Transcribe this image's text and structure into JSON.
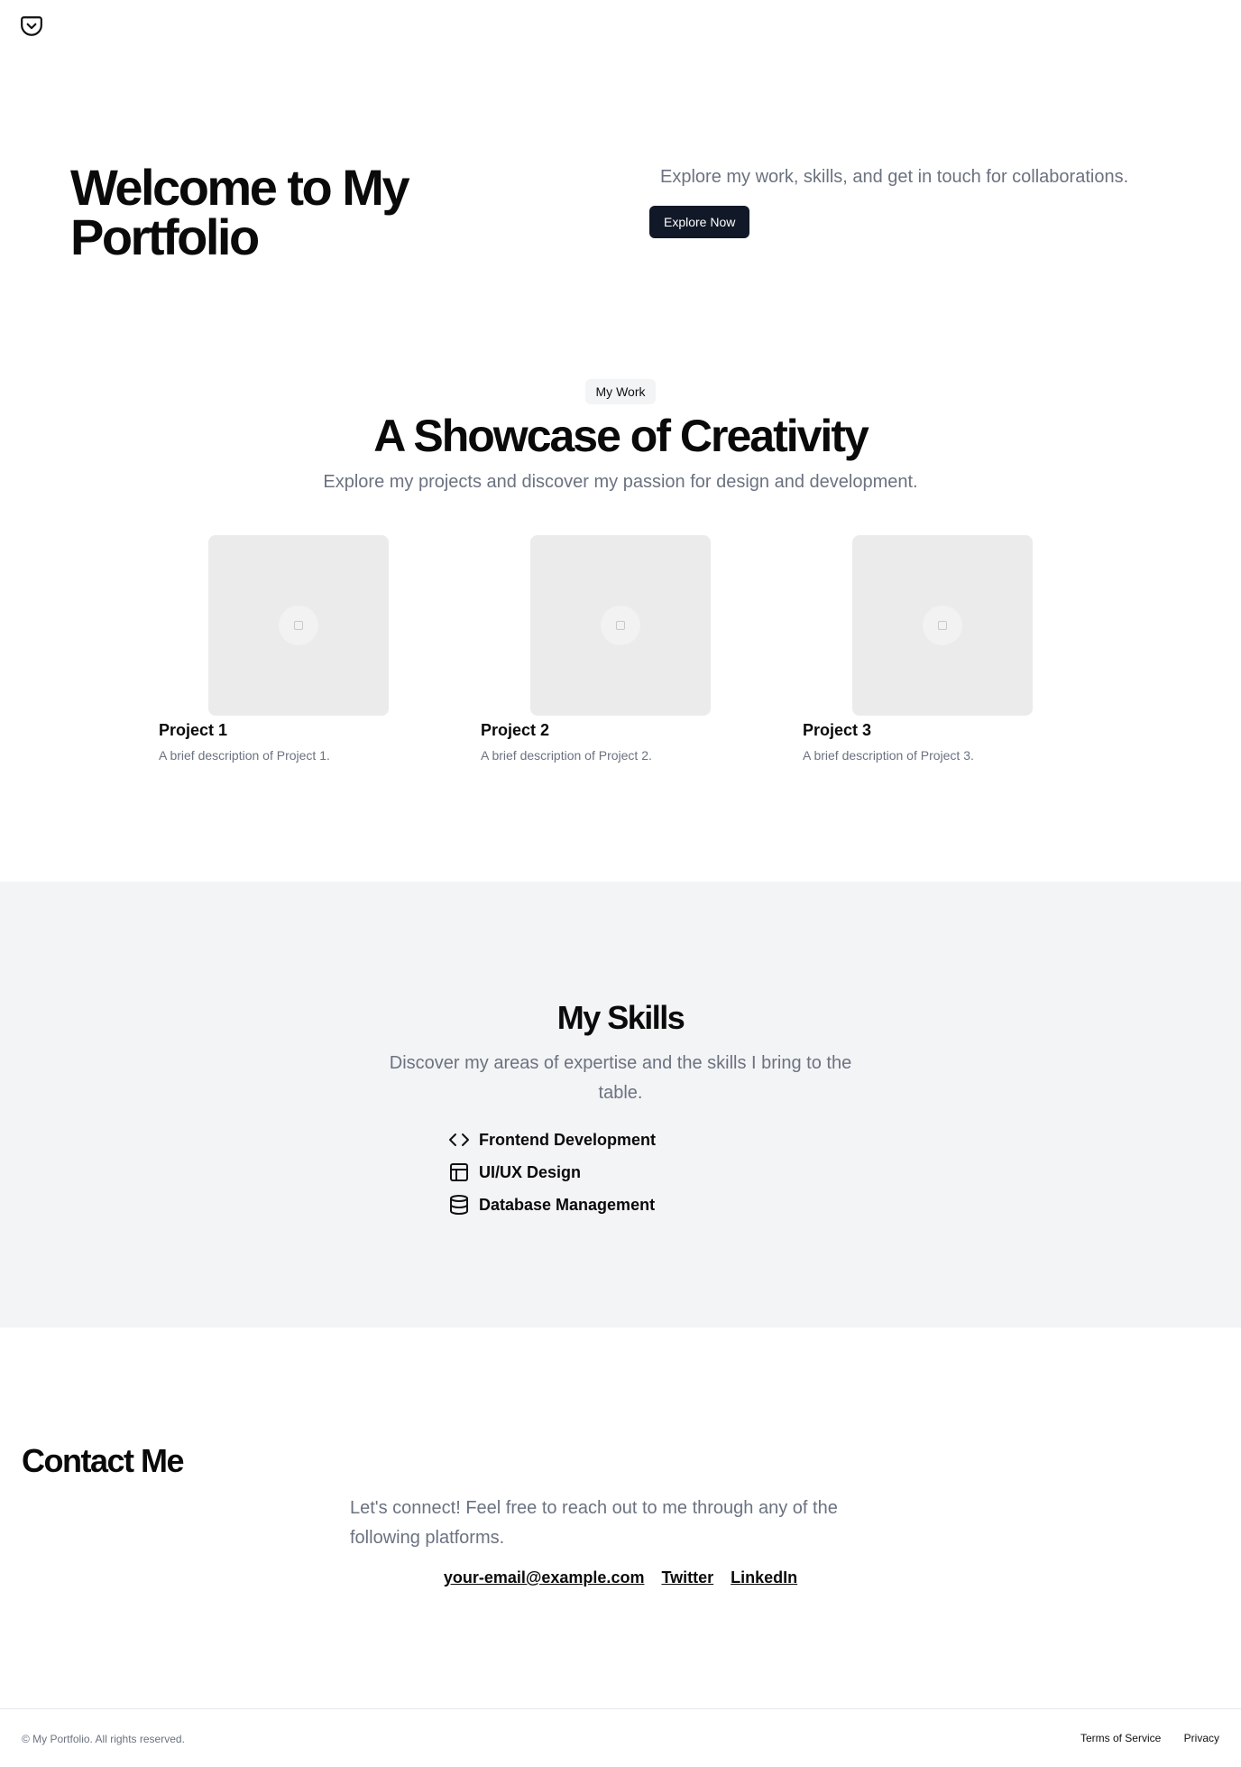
{
  "header": {
    "logo_icon": "pocket-icon"
  },
  "hero": {
    "title": "Welcome to My Portfolio",
    "subtitle": "Explore my work, skills, and get in touch for collaborations.",
    "button_label": "Explore Now"
  },
  "work": {
    "badge": "My Work",
    "title": "A Showcase of Creativity",
    "subtitle": "Explore my projects and discover my passion for design and development.",
    "projects": [
      {
        "title": "Project 1",
        "description": "A brief description of Project 1."
      },
      {
        "title": "Project 2",
        "description": "A brief description of Project 2."
      },
      {
        "title": "Project 3",
        "description": "A brief description of Project 3."
      }
    ]
  },
  "skills": {
    "title": "My Skills",
    "subtitle": "Discover my areas of expertise and the skills I bring to the table.",
    "items": [
      {
        "label": "Frontend Development",
        "icon": "code-icon"
      },
      {
        "label": "UI/UX Design",
        "icon": "layout-icon"
      },
      {
        "label": "Database Management",
        "icon": "database-icon"
      }
    ]
  },
  "contact": {
    "title": "Contact Me",
    "subtitle": "Let's connect! Feel free to reach out to me through any of the following platforms.",
    "links": [
      "your-email@example.com",
      "Twitter",
      "LinkedIn"
    ]
  },
  "footer": {
    "copyright": "© My Portfolio. All rights reserved.",
    "links": [
      "Terms of Service",
      "Privacy"
    ]
  },
  "colors": {
    "button_bg": "#111827",
    "muted_text": "#6b7280",
    "skills_bg": "#f3f4f6"
  }
}
